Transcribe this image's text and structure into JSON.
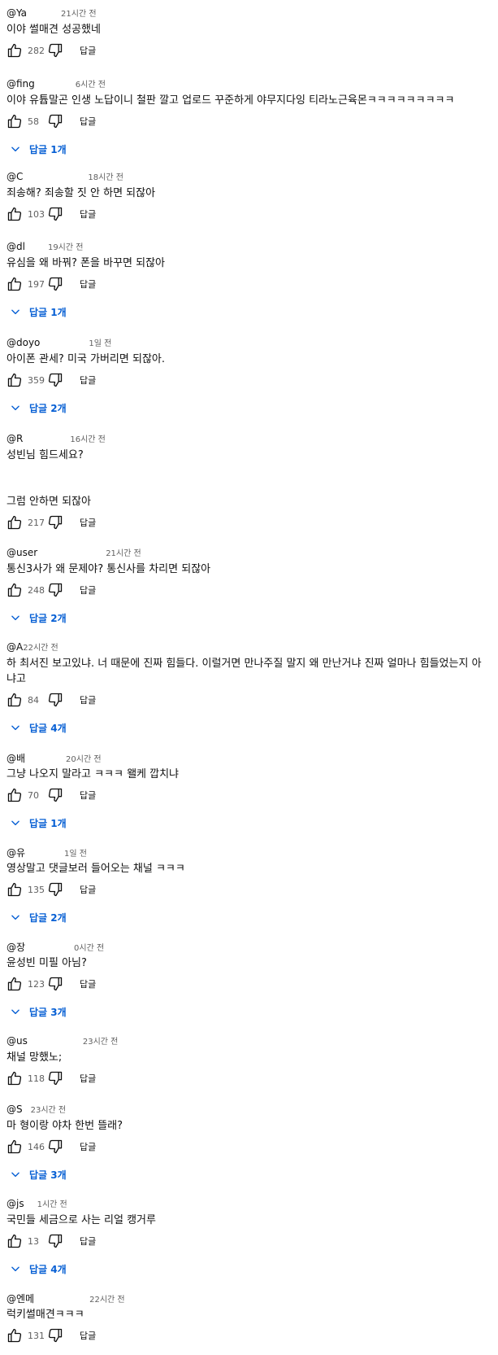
{
  "ui": {
    "reply_label": "답글",
    "accent": "#065fd4"
  },
  "comments": [
    {
      "author": "@Ya",
      "time": "21시간 전",
      "text": "이야 썰매견 성공했네",
      "likes": "282",
      "replies": null
    },
    {
      "author": "@fing",
      "time": "6시간 전",
      "text": "이야 유튭말곤 인생 노답이니 철판 깔고 업로드 꾸준하게 야무지다잉 티라노근육몬ㅋㅋㅋㅋㅋㅋㅋㅋㅋ",
      "likes": "58",
      "replies": "답글 1개"
    },
    {
      "author": "@C",
      "time": "18시간 전",
      "text": "죄송해? 죄송할 짓 안 하면 되잖아",
      "likes": "103",
      "replies": null
    },
    {
      "author": "@dl",
      "time": "19시간 전",
      "text": "유심을 왜 바꿔? 폰을 바꾸면 되잖아",
      "likes": "197",
      "replies": "답글 1개"
    },
    {
      "author": "@doyo",
      "time": "1일 전",
      "text": "아이폰 관세? 미국 가버리면 되잖아.",
      "likes": "359",
      "replies": "답글 2개"
    },
    {
      "author": "@R",
      "time": "16시간 전",
      "text": "성빈님 힘드세요?\n\n\n그럼 안하면 되잖아",
      "likes": "217",
      "replies": null
    },
    {
      "author": "@user",
      "time": "21시간 전",
      "text": "통신3사가 왜 문제야? 통신사를 차리면 되잖아",
      "likes": "248",
      "replies": "답글 2개"
    },
    {
      "author": "@A",
      "time": "22시간 전",
      "text": "하 최서진 보고있냐. 너 때문에 진짜 힘들다. 이럴거면 만나주질 말지 왜 만난거냐 진짜 얼마나 힘들었는지 아\n냐고",
      "likes": "84",
      "replies": "답글 4개"
    },
    {
      "author": "@배",
      "time": "20시간 전",
      "text": "그냥 나오지 말라고 ㅋㅋㅋ 왤케 깝치냐",
      "likes": "70",
      "replies": "답글 1개"
    },
    {
      "author": "@유",
      "time": "1일 전",
      "text": "영상말고 댓글보러 들어오는 채널 ㅋㅋㅋ",
      "likes": "135",
      "replies": "답글 2개"
    },
    {
      "author": "@장",
      "time": "0시간 전",
      "text": "윤성빈 미필 아님?",
      "likes": "123",
      "replies": "답글 3개"
    },
    {
      "author": "@us",
      "time": "23시간 전",
      "text": "채널 망했노;",
      "likes": "118",
      "replies": null
    },
    {
      "author": "@S",
      "time": "23시간 전",
      "text": "마 형이랑 야차 한번 뜰래?",
      "likes": "146",
      "replies": "답글 3개"
    },
    {
      "author": "@js",
      "time": "1시간 전",
      "text": "국민들 세금으로 사는 리얼 캥거루",
      "likes": "13",
      "replies": "답글 4개"
    },
    {
      "author": "@엔메",
      "time": "22시간 전",
      "text": "럭키썰매견ㅋㅋㅋ",
      "likes": "131",
      "replies": null
    }
  ]
}
